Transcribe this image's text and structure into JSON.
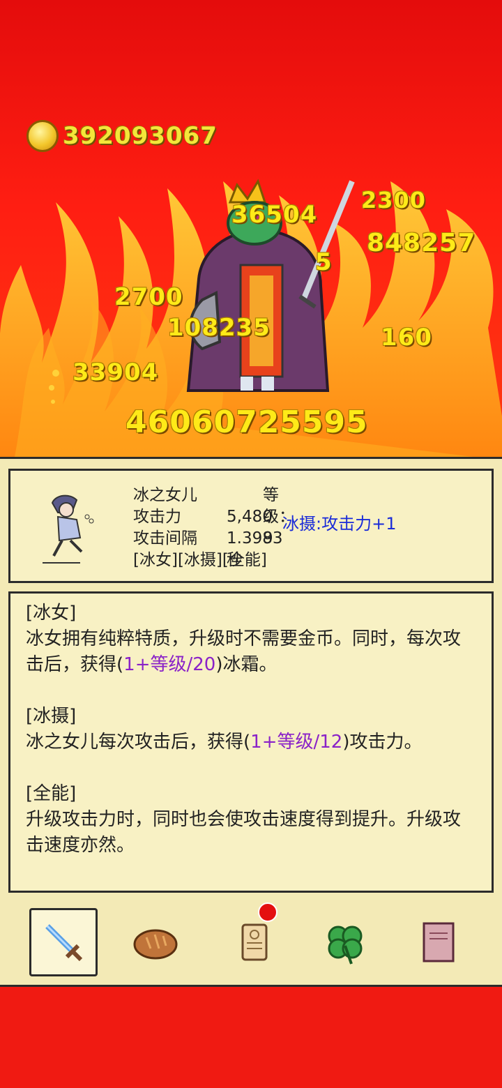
{
  "gold": {
    "amount": "392093067"
  },
  "damage_numbers": [
    {
      "text": "36504"
    },
    {
      "text": "2300"
    },
    {
      "text": "848257"
    },
    {
      "text": "5"
    },
    {
      "text": "2700"
    },
    {
      "text": "108235"
    },
    {
      "text": "160"
    },
    {
      "text": "33904"
    },
    {
      "text": "46060725595"
    }
  ],
  "hero": {
    "name": "冰之女儿",
    "level_label": "等级：9",
    "attack_label": "攻击力",
    "attack_value": "5,480",
    "interval_label": "攻击间隔",
    "interval_value": "1.3983秒",
    "tags": "[冰女][冰摄][全能]",
    "buff": "冰摄:攻击力+1"
  },
  "skills": [
    {
      "title": "[冰女]",
      "text_before": "冰女拥有纯粹特质，升级时不需要金币。同时，每次攻击后，获得(",
      "formula": "1+等级/20",
      "text_after": ")冰霜。"
    },
    {
      "title": "[冰摄]",
      "text_before": "冰之女儿每次攻击后，获得(",
      "formula": "1+等级/12",
      "text_after": ")攻击力。"
    },
    {
      "title": "[全能]",
      "text_before": "升级攻击力时，同时也会使攻击速度得到提升。升级攻击速度亦然。",
      "formula": "",
      "text_after": ""
    }
  ],
  "tabs": [
    {
      "icon": "sword-icon",
      "active": true
    },
    {
      "icon": "bread-icon",
      "active": false
    },
    {
      "icon": "scroll-icon",
      "active": false,
      "badge": true
    },
    {
      "icon": "clover-icon",
      "active": false
    },
    {
      "icon": "book-icon",
      "active": false
    }
  ],
  "colors": {
    "background": "#ef1a10",
    "panel": "#f3eab6",
    "damage": "#ffea18",
    "buff": "#1a2bd8",
    "formula": "#8a22c8"
  }
}
